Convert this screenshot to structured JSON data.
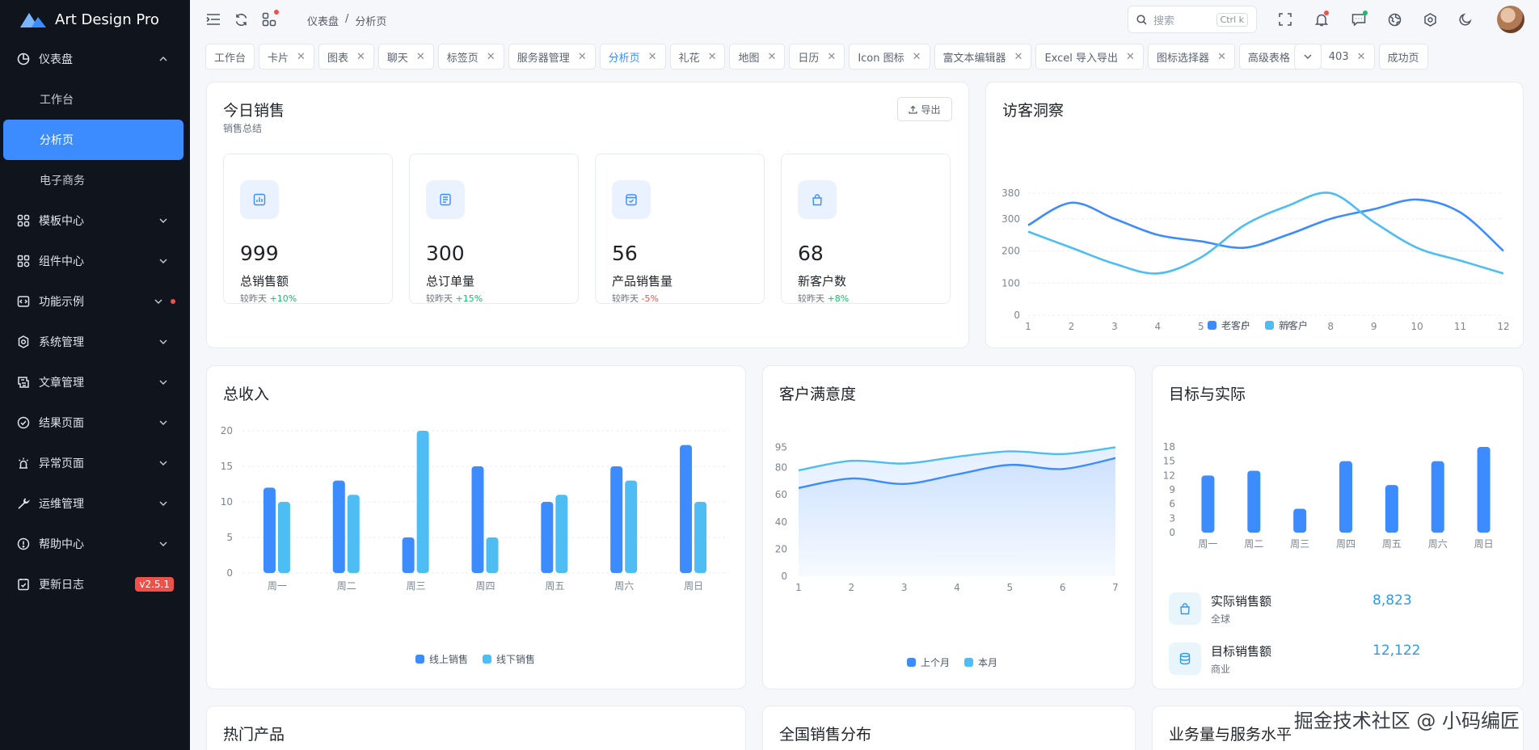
{
  "app": {
    "name": "Art Design Pro",
    "version": "v2.5.1"
  },
  "sidebar": {
    "items": [
      {
        "label": "仪表盘",
        "icon": "dashboard-icon",
        "expanded": true
      },
      {
        "label": "模板中心",
        "icon": "grid-icon"
      },
      {
        "label": "组件中心",
        "icon": "components-icon"
      },
      {
        "label": "功能示例",
        "icon": "code-icon",
        "badge_dot": true
      },
      {
        "label": "系统管理",
        "icon": "gear-icon"
      },
      {
        "label": "文章管理",
        "icon": "article-icon"
      },
      {
        "label": "结果页面",
        "icon": "check-circle-icon"
      },
      {
        "label": "异常页面",
        "icon": "alarm-icon"
      },
      {
        "label": "运维管理",
        "icon": "wrench-icon"
      },
      {
        "label": "帮助中心",
        "icon": "info-icon"
      },
      {
        "label": "更新日志",
        "icon": "changelog-icon"
      }
    ],
    "subitems": [
      "工作台",
      "分析页",
      "电子商务"
    ],
    "active_subitem": "分析页"
  },
  "header": {
    "breadcrumb": [
      "仪表盘",
      "/",
      "分析页"
    ],
    "search_placeholder": "搜索",
    "search_shortcut": "Ctrl k"
  },
  "tabs": [
    {
      "label": "工作台",
      "closable": false
    },
    {
      "label": "卡片",
      "closable": true
    },
    {
      "label": "图表",
      "closable": true
    },
    {
      "label": "聊天",
      "closable": true
    },
    {
      "label": "标签页",
      "closable": true
    },
    {
      "label": "服务器管理",
      "closable": true
    },
    {
      "label": "分析页",
      "closable": true,
      "active": true
    },
    {
      "label": "礼花",
      "closable": true
    },
    {
      "label": "地图",
      "closable": true
    },
    {
      "label": "日历",
      "closable": true
    },
    {
      "label": "Icon 图标",
      "closable": true
    },
    {
      "label": "富文本编辑器",
      "closable": true
    },
    {
      "label": "Excel 导入导出",
      "closable": true
    },
    {
      "label": "图标选择器",
      "closable": true
    },
    {
      "label": "高级表格",
      "closable": true
    },
    {
      "label": "403",
      "closable": true
    },
    {
      "label": "成功页",
      "closable": false
    }
  ],
  "today_sales": {
    "title": "今日销售",
    "subtitle": "销售总结",
    "export_label": "导出",
    "stats": [
      {
        "value": "999",
        "label": "总销售额",
        "cmp_prefix": "较昨天",
        "change": "+10%",
        "trend": "up",
        "icon": "chart-doc-icon"
      },
      {
        "value": "300",
        "label": "总订单量",
        "cmp_prefix": "较昨天",
        "change": "+15%",
        "trend": "up",
        "icon": "order-list-icon"
      },
      {
        "value": "56",
        "label": "产品销售量",
        "cmp_prefix": "较昨天",
        "change": "-5%",
        "trend": "down",
        "icon": "calendar-check-icon"
      },
      {
        "value": "68",
        "label": "新客户数",
        "cmp_prefix": "较昨天",
        "change": "+8%",
        "trend": "up",
        "icon": "bag-icon"
      }
    ]
  },
  "visitor": {
    "title": "访客洞察"
  },
  "income": {
    "title": "总收入"
  },
  "satisfaction": {
    "title": "客户满意度"
  },
  "target": {
    "title": "目标与实际",
    "metrics": [
      {
        "name": "实际销售额",
        "region": "全球",
        "value": "8,823",
        "icon": "bag-icon"
      },
      {
        "name": "目标销售额",
        "region": "商业",
        "value": "12,122",
        "icon": "database-icon"
      }
    ]
  },
  "bottom_cards": [
    "热门产品",
    "全国销售分布",
    "业务量与服务水平"
  ],
  "watermark": "掘金技术社区 @ 小码编匠",
  "colors": {
    "primary": "#3c8cff",
    "secondary": "#4dbdf4",
    "sidebar_bg": "#10141c",
    "danger": "#f1504a",
    "success": "#19be6b"
  },
  "chart_data": [
    {
      "type": "line",
      "title": "访客洞察",
      "x": [
        1,
        2,
        3,
        4,
        5,
        6,
        7,
        8,
        9,
        10,
        11,
        12
      ],
      "series": [
        {
          "name": "老客户",
          "values": [
            280,
            350,
            300,
            250,
            230,
            210,
            250,
            300,
            330,
            360,
            320,
            200
          ]
        },
        {
          "name": "新客户",
          "values": [
            260,
            210,
            160,
            130,
            180,
            280,
            340,
            380,
            290,
            210,
            170,
            130
          ]
        }
      ],
      "yticks": [
        0,
        100,
        200,
        300,
        380
      ],
      "ylim": [
        0,
        400
      ],
      "legend": "bottom"
    },
    {
      "type": "bar",
      "title": "总收入",
      "categories": [
        "周一",
        "周二",
        "周三",
        "周四",
        "周五",
        "周六",
        "周日"
      ],
      "series": [
        {
          "name": "线上销售",
          "values": [
            12,
            13,
            5,
            15,
            10,
            15,
            18
          ]
        },
        {
          "name": "线下销售",
          "values": [
            10,
            11,
            20,
            5,
            11,
            13,
            10
          ]
        }
      ],
      "yticks": [
        0,
        5,
        10,
        15,
        20
      ],
      "ylim": [
        0,
        20
      ],
      "legend": "bottom"
    },
    {
      "type": "area",
      "title": "客户满意度",
      "x": [
        1,
        2,
        3,
        4,
        5,
        6,
        7
      ],
      "series": [
        {
          "name": "上个月",
          "values": [
            65,
            72,
            68,
            75,
            82,
            79,
            87
          ]
        },
        {
          "name": "本月",
          "values": [
            78,
            85,
            83,
            88,
            92,
            90,
            95
          ]
        }
      ],
      "yticks": [
        0,
        20,
        40,
        60,
        80,
        95
      ],
      "ylim": [
        0,
        100
      ],
      "legend": "bottom"
    },
    {
      "type": "bar",
      "title": "目标与实际",
      "categories": [
        "周一",
        "周二",
        "周三",
        "周四",
        "周五",
        "周六",
        "周日"
      ],
      "series": [
        {
          "values": [
            12,
            13,
            5,
            15,
            10,
            15,
            18
          ]
        }
      ],
      "yticks": [
        0,
        3,
        6,
        9,
        12,
        15,
        18
      ],
      "ylim": [
        0,
        18
      ]
    }
  ]
}
